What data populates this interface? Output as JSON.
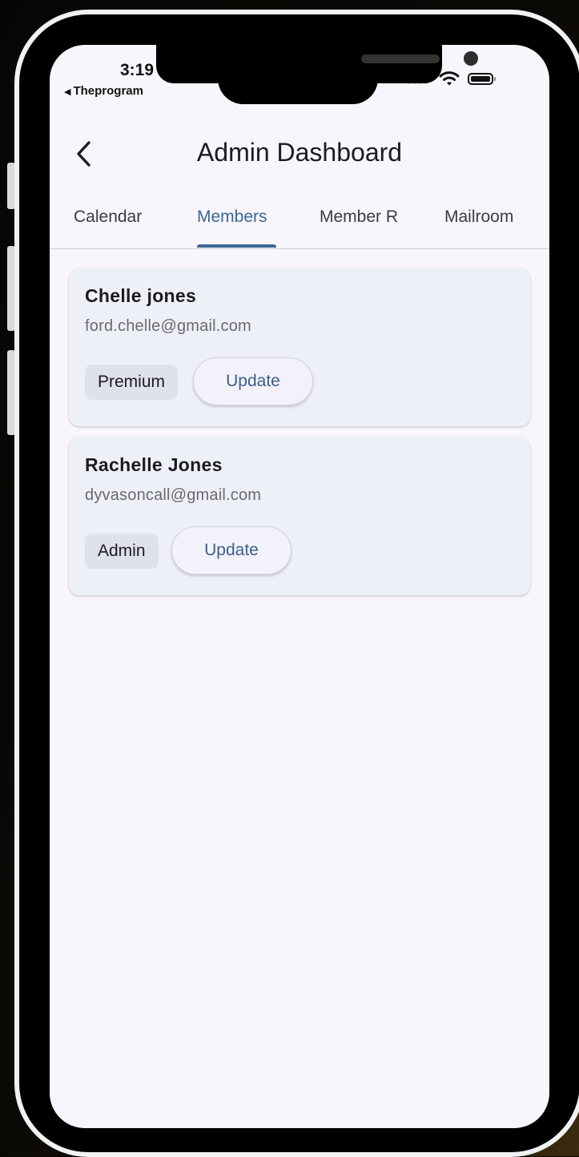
{
  "status_bar": {
    "time": "3:19",
    "back_app": "Theprogram",
    "back_arrow": "◀"
  },
  "app_bar": {
    "title": "Admin Dashboard",
    "back_icon": "chevron-left-icon"
  },
  "tabs": [
    {
      "label": "Calendar",
      "active": false
    },
    {
      "label": "Members",
      "active": true
    },
    {
      "label": "Member R",
      "active": false
    },
    {
      "label": "Mailroom",
      "active": false
    }
  ],
  "members": [
    {
      "name": "Chelle jones",
      "email": "ford.chelle@gmail.com",
      "role": "Premium",
      "action": "Update"
    },
    {
      "name": "Rachelle Jones",
      "email": "dyvasoncall@gmail.com",
      "role": "Admin",
      "action": "Update"
    }
  ],
  "colors": {
    "accent": "#3c6795",
    "screen_background": "#f8f5fc",
    "card_background": "#eef0f8",
    "chip_background": "#dfe2eb"
  }
}
